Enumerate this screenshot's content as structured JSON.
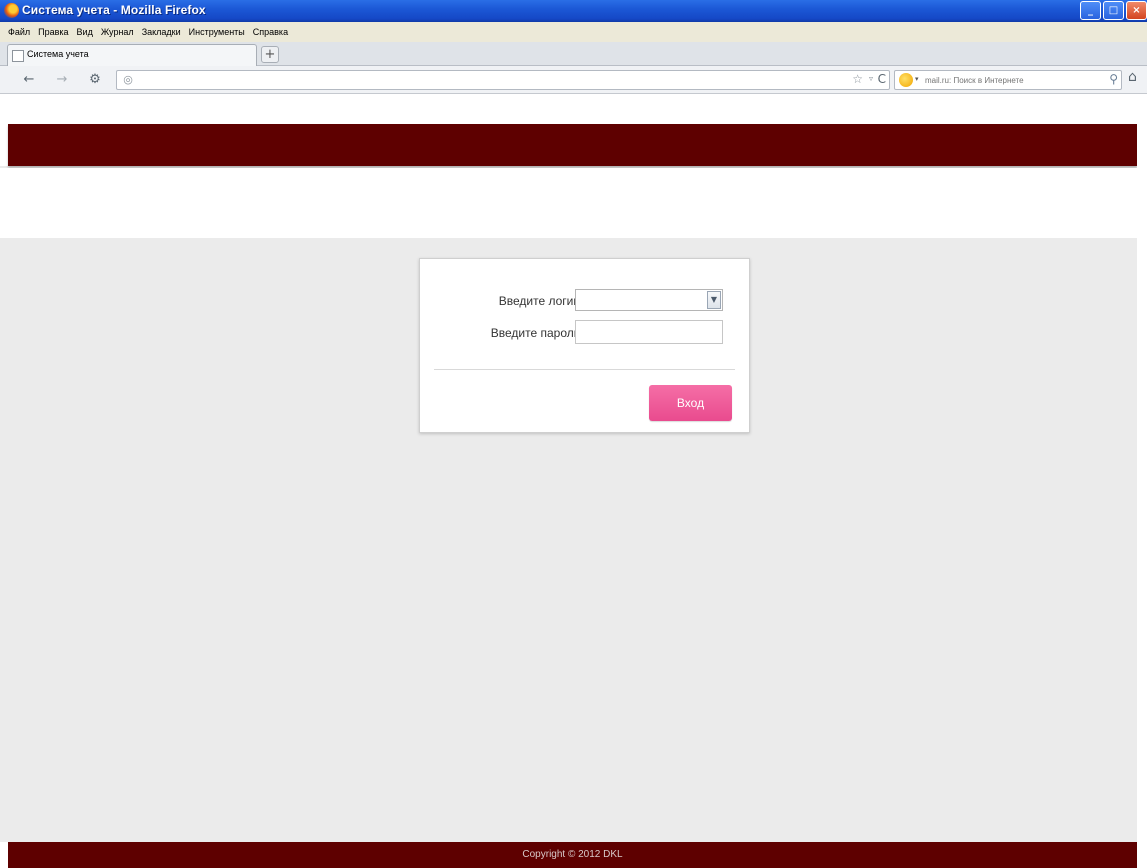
{
  "window": {
    "title": "Система учета - Mozilla Firefox",
    "controls": {
      "minimize": "_",
      "maximize": "□",
      "close": "×"
    }
  },
  "menubar": {
    "items": [
      {
        "label": "Файл"
      },
      {
        "label": "Правка"
      },
      {
        "label": "Вид"
      },
      {
        "label": "Журнал"
      },
      {
        "label": "Закладки"
      },
      {
        "label": "Инструменты"
      },
      {
        "label": "Справка"
      }
    ]
  },
  "tabs": {
    "items": [
      {
        "label": "Система учета"
      }
    ],
    "new_tab": "+"
  },
  "navbar": {
    "back": "←",
    "forward": "→",
    "history": "⚙",
    "url": "",
    "star": "☆",
    "dropdown": "▿",
    "reload": "C",
    "search_placeholder": "mail.ru: Поиск в Интернете",
    "home": "⌂"
  },
  "login": {
    "login_label": "Введите логин",
    "password_label": "Введите пароль",
    "login_value": "",
    "submit_label": "Вход"
  },
  "footer": {
    "copyright": "Copyright © 2012 DKL"
  },
  "colors": {
    "brand_dark_red": "#5e0000",
    "button_pink": "#e94b8e",
    "page_bg": "#ebebeb"
  }
}
